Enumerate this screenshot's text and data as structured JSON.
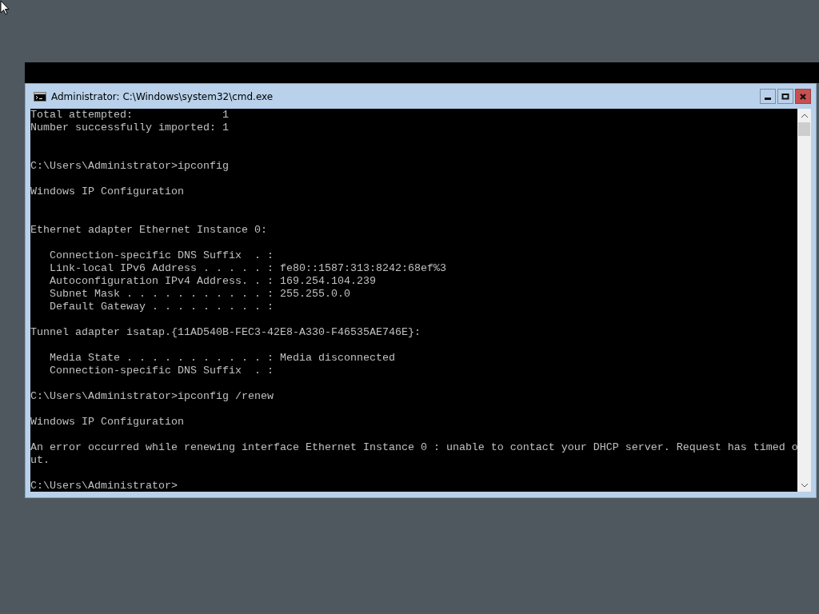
{
  "window": {
    "title": "Administrator: C:\\Windows\\system32\\cmd.exe"
  },
  "console": {
    "lines": [
      {
        "text": "Total attempted:              1",
        "kind": "plain"
      },
      {
        "text": "Number successfully imported: 1",
        "kind": "plain"
      },
      {
        "text": "C:\\Users\\Administrator>ipconfig",
        "kind": "wide"
      },
      {
        "text": "Windows IP Configuration",
        "kind": "spaced"
      },
      {
        "text": "Ethernet adapter Ethernet Instance 0:",
        "kind": "wide"
      },
      {
        "text": "   Connection-specific DNS Suffix  . :",
        "kind": "spaced"
      },
      {
        "text": "   Link-local IPv6 Address . . . . . : fe80::1587:313:8242:68ef%3",
        "kind": "plain"
      },
      {
        "text": "   Autoconfiguration IPv4 Address. . : 169.254.104.239",
        "kind": "plain"
      },
      {
        "text": "   Subnet Mask . . . . . . . . . . . : 255.255.0.0",
        "kind": "plain"
      },
      {
        "text": "   Default Gateway . . . . . . . . . :",
        "kind": "plain"
      },
      {
        "text": "Tunnel adapter isatap.{11AD540B-FEC3-42E8-A330-F46535AE746E}:",
        "kind": "spaced"
      },
      {
        "text": "   Media State . . . . . . . . . . . : Media disconnected",
        "kind": "spaced"
      },
      {
        "text": "   Connection-specific DNS Suffix  . :",
        "kind": "plain"
      },
      {
        "text": "C:\\Users\\Administrator>ipconfig /renew",
        "kind": "spaced"
      },
      {
        "text": "Windows IP Configuration",
        "kind": "spaced"
      },
      {
        "text": "An error occurred while renewing interface Ethernet Instance 0 : unable to contact your DHCP server. Request has timed o",
        "kind": "spaced"
      },
      {
        "text": "ut.",
        "kind": "plain"
      },
      {
        "text": "C:\\Users\\Administrator>",
        "kind": "spaced"
      }
    ]
  }
}
